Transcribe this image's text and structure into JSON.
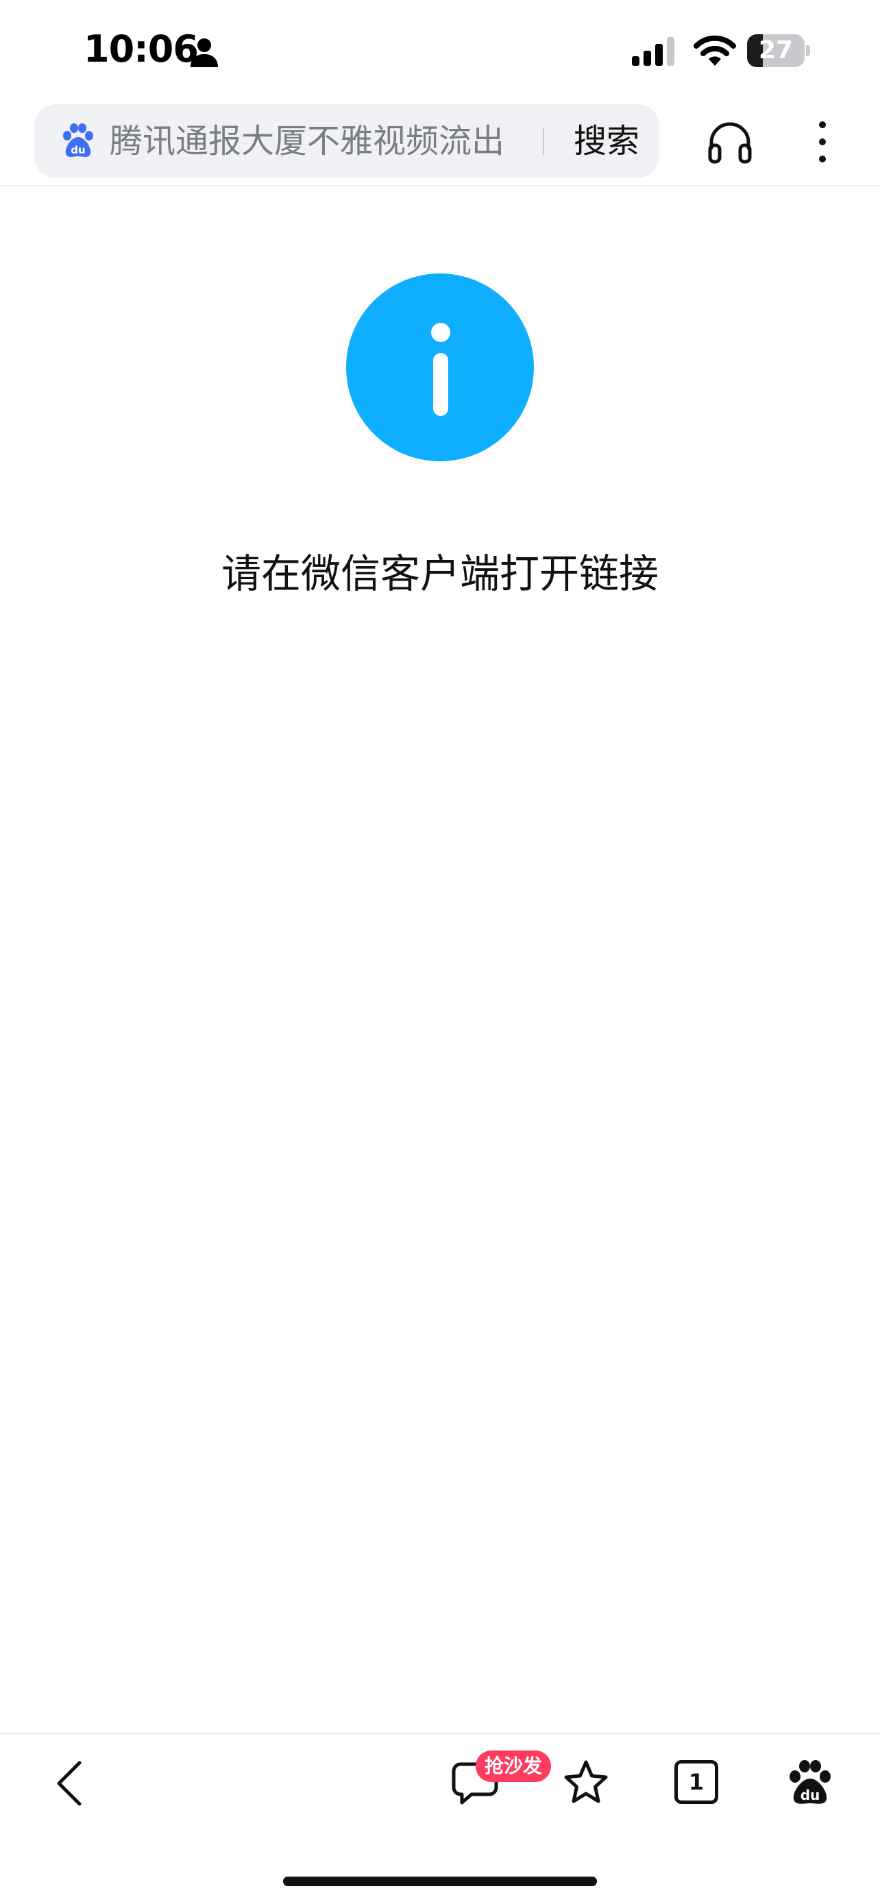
{
  "status_bar": {
    "time": "10:06",
    "battery_level": "27",
    "icons": [
      "person-icon",
      "signal-icon",
      "wifi-icon",
      "battery-icon"
    ]
  },
  "header": {
    "search_query": "腾讯通报大厦不雅视频流出",
    "search_button": "搜索",
    "icons": [
      "baidu-logo-icon",
      "headphones-icon",
      "more-vertical-icon"
    ]
  },
  "content": {
    "icon": "info-icon",
    "message": "请在微信客户端打开链接"
  },
  "toolbar": {
    "comment_badge": "抢沙发",
    "tab_count": "1",
    "icons": [
      "back-icon",
      "comment-icon",
      "star-icon",
      "tabs-icon",
      "baidu-home-icon"
    ]
  },
  "colors": {
    "info_blue": "#10aefe",
    "baidu_blue": "#3e6ff2",
    "badge_red": "#fd3a60"
  }
}
